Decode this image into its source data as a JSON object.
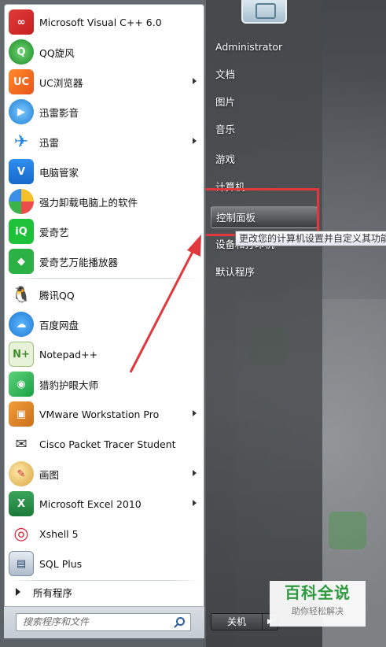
{
  "programs": [
    {
      "label": "Microsoft Visual C++ 6.0",
      "icon": "visual-cpp-icon",
      "submenu": false
    },
    {
      "label": "QQ旋风",
      "icon": "qq-xuanfeng-icon",
      "submenu": false
    },
    {
      "label": "UC浏览器",
      "icon": "uc-browser-icon",
      "submenu": true
    },
    {
      "label": "迅雷影音",
      "icon": "xunlei-player-icon",
      "submenu": false
    },
    {
      "label": "迅雷",
      "icon": "xunlei-icon",
      "submenu": true
    },
    {
      "label": "电脑管家",
      "icon": "pc-manager-icon",
      "submenu": false
    },
    {
      "label": "强力卸载电脑上的软件",
      "icon": "uninstaller-icon",
      "submenu": false
    },
    {
      "label": "爱奇艺",
      "icon": "iqiyi-icon",
      "submenu": false
    },
    {
      "label": "爱奇艺万能播放器",
      "icon": "iqiyi-player-icon",
      "submenu": false
    },
    {
      "label": "腾讯QQ",
      "icon": "qq-icon",
      "submenu": false
    },
    {
      "label": "百度网盘",
      "icon": "baidu-netdisk-icon",
      "submenu": false
    },
    {
      "label": "Notepad++",
      "icon": "notepad-plus-icon",
      "submenu": false
    },
    {
      "label": "猎豹护眼大师",
      "icon": "eye-care-icon",
      "submenu": false
    },
    {
      "label": "VMware Workstation Pro",
      "icon": "vmware-icon",
      "submenu": true
    },
    {
      "label": "Cisco Packet Tracer Student",
      "icon": "packet-tracer-icon",
      "submenu": false
    },
    {
      "label": "画图",
      "icon": "paint-icon",
      "submenu": true
    },
    {
      "label": "Microsoft Excel 2010",
      "icon": "excel-icon",
      "submenu": true
    },
    {
      "label": "Xshell 5",
      "icon": "xshell-icon",
      "submenu": false
    },
    {
      "label": "SQL Plus",
      "icon": "sql-plus-icon",
      "submenu": false
    }
  ],
  "all_programs_label": "所有程序",
  "search_placeholder": "搜索程序和文件",
  "right_menu": {
    "user": "Administrator",
    "documents": "文档",
    "pictures": "图片",
    "music": "音乐",
    "games": "游戏",
    "computer": "计算机",
    "control_panel": "控制面板",
    "devices": "设备和打印机",
    "default_programs": "默认程序"
  },
  "tooltip": "更改您的计算机设置并自定义其功能。",
  "shutdown_label": "关机",
  "watermark": {
    "title": "百科全说",
    "subtitle": "助你轻松解决"
  },
  "colors": {
    "highlight": "#e0383c",
    "watermark_green": "#2d9a3f"
  }
}
